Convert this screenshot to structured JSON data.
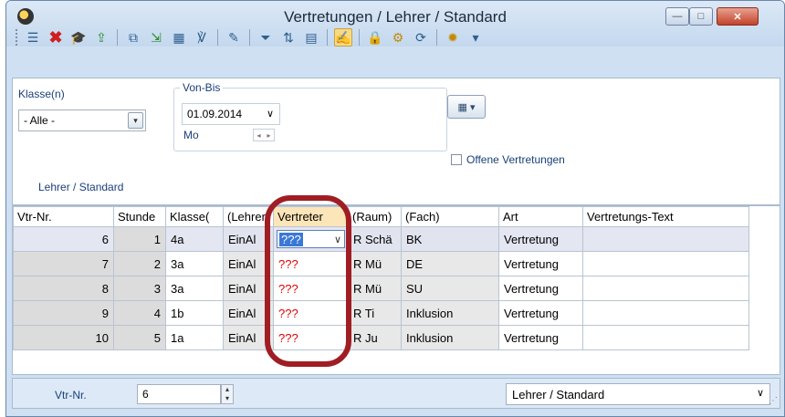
{
  "window": {
    "title": "Vertretungen / Lehrer / Standard",
    "controls": {
      "minimize": "—",
      "maximize": "□",
      "close": "✕"
    }
  },
  "toolbar": {
    "icons": [
      "list-icon",
      "delete-icon",
      "teacher-icon",
      "import-icon",
      "copy-icon",
      "export-icon",
      "calculator-icon",
      "mark-icon",
      "tools-icon",
      "filter-icon",
      "sort-icon",
      "table-icon",
      "edit-icon",
      "lock-icon",
      "settings-icon",
      "refresh-icon",
      "gear-icon"
    ]
  },
  "filter": {
    "klasse_label": "Klasse(n)",
    "klasse_value": "- Alle -",
    "vonbis_label": "Von-Bis",
    "date_value": "01.09.2014",
    "weekday": "Mo",
    "offene_label": "Offene Vertretungen",
    "view_label": "Lehrer / Standard"
  },
  "table": {
    "columns": [
      "Vtr-Nr.",
      "Stunde",
      "Klasse(",
      "(Lehrer",
      "Vertreter",
      "(Raum)",
      "(Fach)",
      "Art",
      "Vertretungs-Text"
    ],
    "rows": [
      {
        "vtr": "6",
        "stunde": "1",
        "klasse": "4a",
        "lehrer": "EinAl",
        "vertreter": "???",
        "raum": "R Schä",
        "fach": "BK",
        "art": "Vertretung",
        "text": ""
      },
      {
        "vtr": "7",
        "stunde": "2",
        "klasse": "3a",
        "lehrer": "EinAl",
        "vertreter": "???",
        "raum": "R Mü",
        "fach": "DE",
        "art": "Vertretung",
        "text": ""
      },
      {
        "vtr": "8",
        "stunde": "3",
        "klasse": "3a",
        "lehrer": "EinAl",
        "vertreter": "???",
        "raum": "R Mü",
        "fach": "SU",
        "art": "Vertretung",
        "text": ""
      },
      {
        "vtr": "9",
        "stunde": "4",
        "klasse": "1b",
        "lehrer": "EinAl",
        "vertreter": "???",
        "raum": "R Ti",
        "fach": "Inklusion",
        "art": "Vertretung",
        "text": ""
      },
      {
        "vtr": "10",
        "stunde": "5",
        "klasse": "1a",
        "lehrer": "EinAl",
        "vertreter": "???",
        "raum": "R Ju",
        "fach": "Inklusion",
        "art": "Vertretung",
        "text": ""
      }
    ]
  },
  "statusbar": {
    "vtr_label": "Vtr-Nr.",
    "vtr_value": "6",
    "view_value": "Lehrer / Standard"
  },
  "colors": {
    "highlight_ring": "#a01d23",
    "placeholder_text": "#e00000"
  }
}
